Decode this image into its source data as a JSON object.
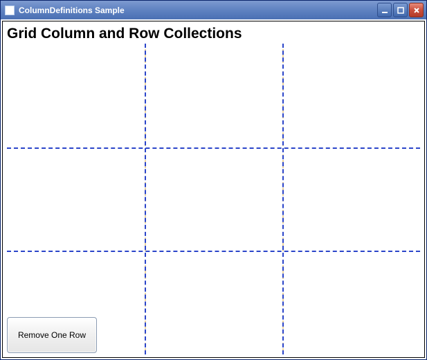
{
  "window": {
    "title": "ColumnDefinitions Sample"
  },
  "content": {
    "heading": "Grid Column and Row Collections",
    "remove_button_label": "Remove One Row"
  },
  "grid": {
    "columns": 3,
    "rows": 3
  }
}
